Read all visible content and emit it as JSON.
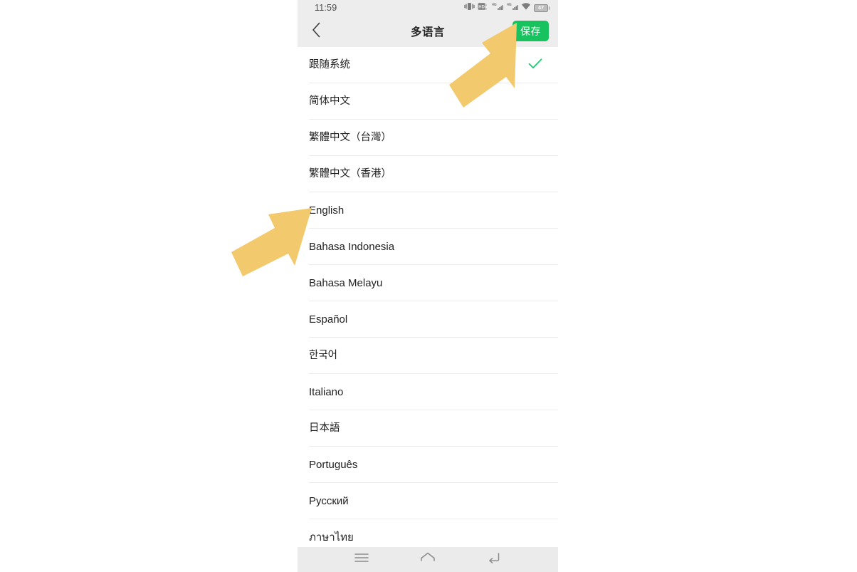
{
  "status_bar": {
    "time": "11:59",
    "icons": [
      "vibrate-icon",
      "hd-volte-icon",
      "signal-4g-sim1-icon",
      "signal-4g-sim2-icon",
      "wifi-icon",
      "battery-icon"
    ],
    "battery_level": "47",
    "network_label": "4G",
    "hd_label": "HD"
  },
  "header": {
    "back_icon": "chevron-left-icon",
    "title": "多语言",
    "save_label": "保存",
    "save_color": "#18C25E"
  },
  "list": {
    "selected_index": 0,
    "check_icon": "check-icon",
    "check_color": "#1ECB73",
    "items": [
      {
        "label": "跟随系统",
        "cjk": true,
        "selected": true
      },
      {
        "label": "简体中文",
        "cjk": true,
        "selected": false
      },
      {
        "label": "繁體中文（台灣）",
        "cjk": true,
        "selected": false
      },
      {
        "label": "繁體中文（香港）",
        "cjk": true,
        "selected": false
      },
      {
        "label": "English",
        "cjk": false,
        "selected": false
      },
      {
        "label": "Bahasa Indonesia",
        "cjk": false,
        "selected": false
      },
      {
        "label": "Bahasa Melayu",
        "cjk": false,
        "selected": false
      },
      {
        "label": "Español",
        "cjk": false,
        "selected": false
      },
      {
        "label": "한국어",
        "cjk": true,
        "selected": false
      },
      {
        "label": "Italiano",
        "cjk": false,
        "selected": false
      },
      {
        "label": "日本語",
        "cjk": true,
        "selected": false
      },
      {
        "label": "Português",
        "cjk": false,
        "selected": false
      },
      {
        "label": "Русский",
        "cjk": false,
        "selected": false
      },
      {
        "label": "ภาษาไทย",
        "cjk": false,
        "selected": false
      }
    ]
  },
  "bottom_nav": {
    "buttons": [
      {
        "icon": "menu-recents-icon"
      },
      {
        "icon": "home-icon"
      },
      {
        "icon": "back-return-icon"
      }
    ]
  },
  "annotations": {
    "color": "#F2C96C",
    "arrows": [
      {
        "name": "arrow-pointing-to-save-button",
        "target": "保存"
      },
      {
        "name": "arrow-pointing-to-english-row",
        "target": "English"
      }
    ]
  }
}
